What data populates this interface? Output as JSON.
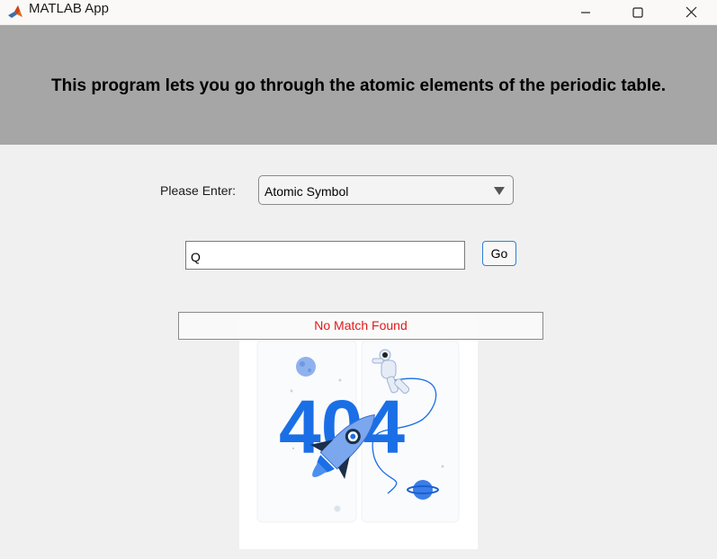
{
  "window": {
    "title": "MATLAB App",
    "icon": "matlab-logo-icon",
    "controls": [
      "minimize-icon",
      "maximize-icon",
      "close-icon"
    ]
  },
  "header": {
    "text": "This program lets you go through the atomic elements of the periodic table.",
    "background": "#a6a6a6"
  },
  "form": {
    "enter_label": "Please Enter:",
    "dropdown": {
      "selected": "Atomic Symbol",
      "icon": "chevron-down-icon"
    },
    "input": {
      "value": "Q"
    },
    "go_label": "Go"
  },
  "result": {
    "text": "No Match Found",
    "color": "#e01a1a"
  },
  "illustration": {
    "digits": "404",
    "description_icon": "404-astronaut-rocket-illustration",
    "accent": "#1a6fe6"
  }
}
